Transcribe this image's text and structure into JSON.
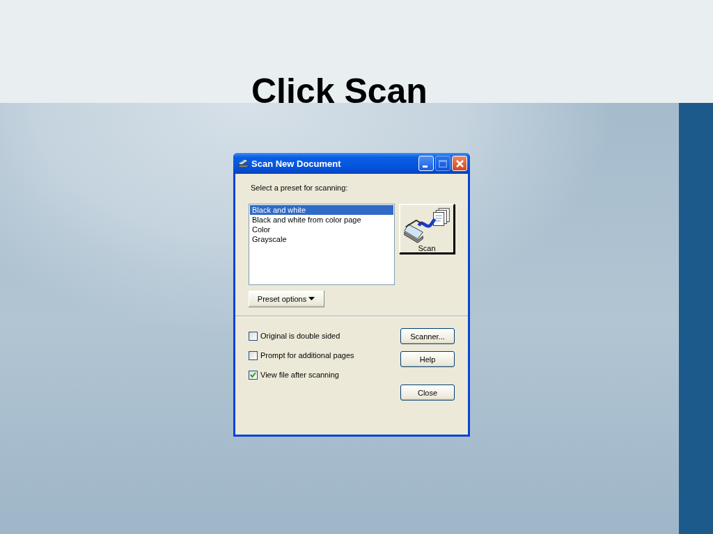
{
  "slide": {
    "title": "Click Scan"
  },
  "window": {
    "title": "Scan New Document",
    "controls": [
      {
        "kind": "minimize",
        "disabled": false
      },
      {
        "kind": "maximize",
        "disabled": true
      },
      {
        "kind": "close",
        "disabled": false
      }
    ]
  },
  "preset_label": "Select a preset for scanning:",
  "presets": [
    {
      "label": "Black and white",
      "selected": true
    },
    {
      "label": "Black and white from color page",
      "selected": false
    },
    {
      "label": "Color",
      "selected": false
    },
    {
      "label": "Grayscale",
      "selected": false
    }
  ],
  "scan_button": {
    "label": "Scan"
  },
  "preset_options_button": {
    "label": "Preset options"
  },
  "options": [
    {
      "label": "Original is double sided",
      "checked": false
    },
    {
      "label": "Prompt for additional pages",
      "checked": false
    },
    {
      "label": "View file after scanning",
      "checked": true
    }
  ],
  "buttons": [
    "Scanner...",
    "Help",
    "Close"
  ]
}
